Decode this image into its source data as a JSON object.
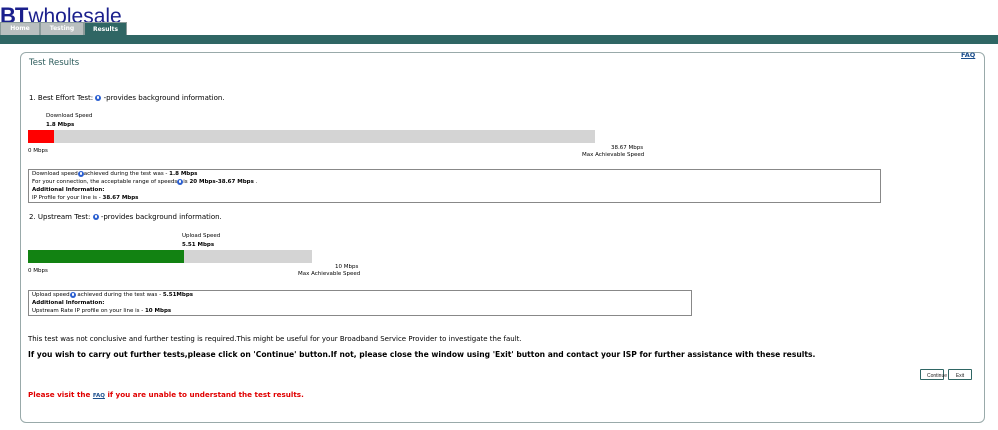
{
  "header": {
    "logo_bt": "BT",
    "logo_wholesale": "wholesale",
    "tabs": [
      {
        "label": "Home"
      },
      {
        "label": "Testing"
      },
      {
        "label": "Results"
      }
    ]
  },
  "faq_link": "FAQ",
  "page_title": "Test Results",
  "best_effort": {
    "heading_start": "1. Best Effort Test: ",
    "heading_end": " -provides background information.",
    "speed_label": "Download Speed",
    "speed_value": "1.8 Mbps",
    "bar_min_label": "0 Mbps",
    "bar_max_label": "38.67 Mbps",
    "bar_max_caption": "Max Achievable Speed",
    "fill_fraction": 0.0465,
    "fill_color": "#ff0000",
    "info_line1_a": "Download speed",
    "info_line1_b": "achieved during the test was - ",
    "info_line1_value": "1.8 Mbps",
    "info_line2_a": "For your connection, the acceptable range of speeds",
    "info_line2_b": "is ",
    "info_line2_value": "20 Mbps-38.67 Mbps",
    "info_line2_end": " .",
    "info_line3": "Additional Information:",
    "info_line4_a": "IP Profile for your line is - ",
    "info_line4_value": "38.67 Mbps"
  },
  "upstream": {
    "heading_start": "2. Upstream Test: ",
    "heading_end": " -provides background information.",
    "speed_label": "Upload Speed",
    "speed_value": "5.51 Mbps",
    "bar_min_label": "0 Mbps",
    "bar_max_label": "10 Mbps",
    "bar_max_caption": "Max Achievable Speed",
    "fill_fraction": 0.551,
    "fill_color": "#128212",
    "info_line1_a": "Upload speed",
    "info_line1_b": " achieved during the test was - ",
    "info_line1_value": "5.51Mbps",
    "info_line2": "Additional Information:",
    "info_line3_a": "Upstream Rate IP profile on your line is - ",
    "info_line3_value": "10 Mbps"
  },
  "conclusion": "This test was not conclusive and further testing is required.This might be useful for your Broadband Service Provider to investigate the fault.",
  "instruction": "If you wish to carry out further tests,please click on 'Continue' button.If not, please close the window using 'Exit' button and contact your ISP for further assistance with these results.",
  "buttons": {
    "continue": "Continue",
    "exit": "Exit"
  },
  "footer": {
    "prefix": "Please visit the ",
    "link": "FAQ",
    "suffix": " if you are unable to understand the test results."
  }
}
